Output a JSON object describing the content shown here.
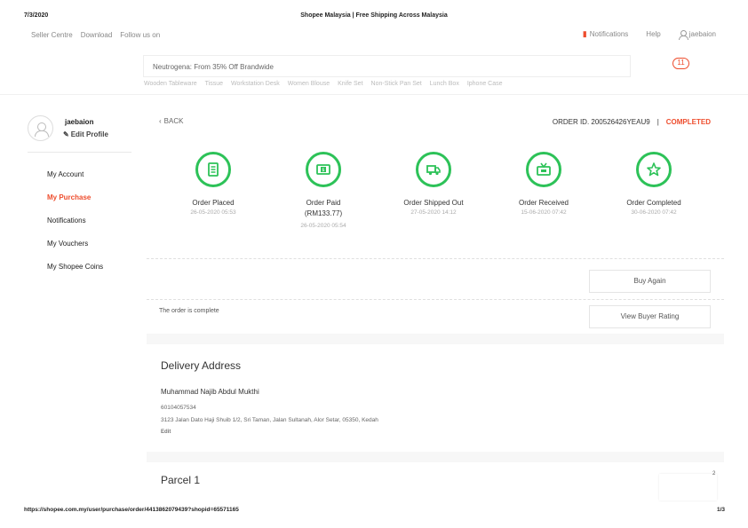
{
  "print": {
    "date": "7/3/2020",
    "title": "Shopee Malaysia | Free Shipping Across Malaysia",
    "url": "https://shopee.com.my/user/purchase/order/4413862079439?shopid=65571165",
    "page": "1/3"
  },
  "top_nav": {
    "left": [
      "Seller Centre",
      "Download",
      "Follow us on"
    ],
    "notifications": "Notifications",
    "help": "Help",
    "username": "jaebaion"
  },
  "search": {
    "placeholder": "Neutrogena: From 35% Off Brandwide",
    "suggestions": [
      "Wooden Tableware",
      "Tissue",
      "Workstation Desk",
      "Women Blouse",
      "Knife Set",
      "Non-Stick Pan Set",
      "Lunch Box",
      "Iphone Case"
    ]
  },
  "cart": {
    "count": "11"
  },
  "sidebar": {
    "username": "jaebaion",
    "edit_profile": "Edit Profile",
    "items": [
      "My Account",
      "My Purchase",
      "Notifications",
      "My Vouchers",
      "My Shopee Coins"
    ]
  },
  "order": {
    "back": "BACK",
    "id_label": "ORDER ID. 200526426YEAU9",
    "separator": "|",
    "status": "COMPLETED",
    "steps": [
      {
        "label": "Order Placed",
        "sub": "",
        "time": "26-05-2020 05:53",
        "icon": "receipt-icon"
      },
      {
        "label": "Order Paid",
        "sub": "(RM133.77)",
        "time": "26-05-2020 05:54",
        "icon": "money-icon"
      },
      {
        "label": "Order Shipped Out",
        "sub": "",
        "time": "27-05-2020 14:12",
        "icon": "truck-icon"
      },
      {
        "label": "Order Received",
        "sub": "",
        "time": "15-06-2020 07:42",
        "icon": "inbox-icon"
      },
      {
        "label": "Order Completed",
        "sub": "",
        "time": "30-06-2020 07:42",
        "icon": "star-icon"
      }
    ],
    "buy_again": "Buy Again",
    "complete_note": "The order is complete",
    "view_rating": "View Buyer Rating"
  },
  "delivery": {
    "title": "Delivery Address",
    "name": "Muhammad Najib Abdul Mukthi",
    "phone": "60104057534",
    "address": "3123 Jalan Dato Haji Shuib 1/2, Sri Taman, Jalan Sultanah, Alor Setar, 05350, Kedah",
    "edit": "Edit"
  },
  "parcel": {
    "title": "Parcel 1",
    "corner_number": "2"
  },
  "colors": {
    "accent": "#ee4d2d",
    "success": "#2dc258"
  }
}
